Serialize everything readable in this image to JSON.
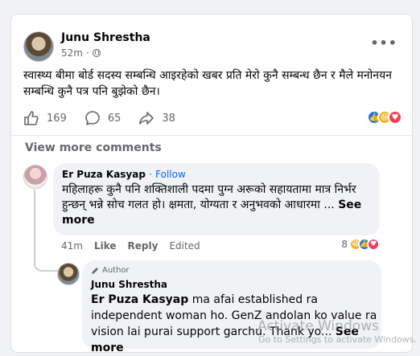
{
  "post": {
    "author": "Junu Shrestha",
    "time": "52m",
    "separator": "·",
    "more_label": "•••",
    "text": "स्वास्थ्य बीमा बोर्ड सदस्य सम्बन्धि आइरहेको खबर प्रति मेरो कुनै सम्बन्ध छैन र मैले मनोनयन सम्बन्धि कुनै पत्र पनि बुझेको छैन।",
    "like_count": "169",
    "comment_count": "65",
    "share_count": "38",
    "icons": {
      "like": "thumbs-up-icon",
      "comment": "comment-icon",
      "share": "share-icon",
      "privacy": "globe-icon"
    }
  },
  "colors": {
    "like": "#1877f2",
    "haha": "#f7b125",
    "love": "#f33e58",
    "link": "#0866ff"
  },
  "comments": {
    "view_more": "View more comments",
    "first": {
      "author": "Er Puza Kasyap",
      "dot": "·",
      "follow": "Follow",
      "text": "महिलाहरू कुनै पनि शक्तिशाली पदमा पुग्न अरूको सहायतामा मात्र निर्भर हुन्छन् भन्ने सोच गलत हो। क्षमता, योग्यता र अनुभवको आधारमा ...",
      "see_more": "See more",
      "time": "41m",
      "like": "Like",
      "reply": "Reply",
      "edited": "Edited",
      "reaction_count": "8"
    },
    "reply": {
      "badge": "Author",
      "author": "Junu Shrestha",
      "mention": "Er Puza Kasyap",
      "text": " ma afai established ra independent woman ho. GenZ andolan ko value ra vision lai purai support garchu. Thank yo...",
      "see_more": "See more"
    }
  },
  "watermark": {
    "line1": "Activate Windows",
    "line2": "Go to Settings to activate Windows."
  }
}
